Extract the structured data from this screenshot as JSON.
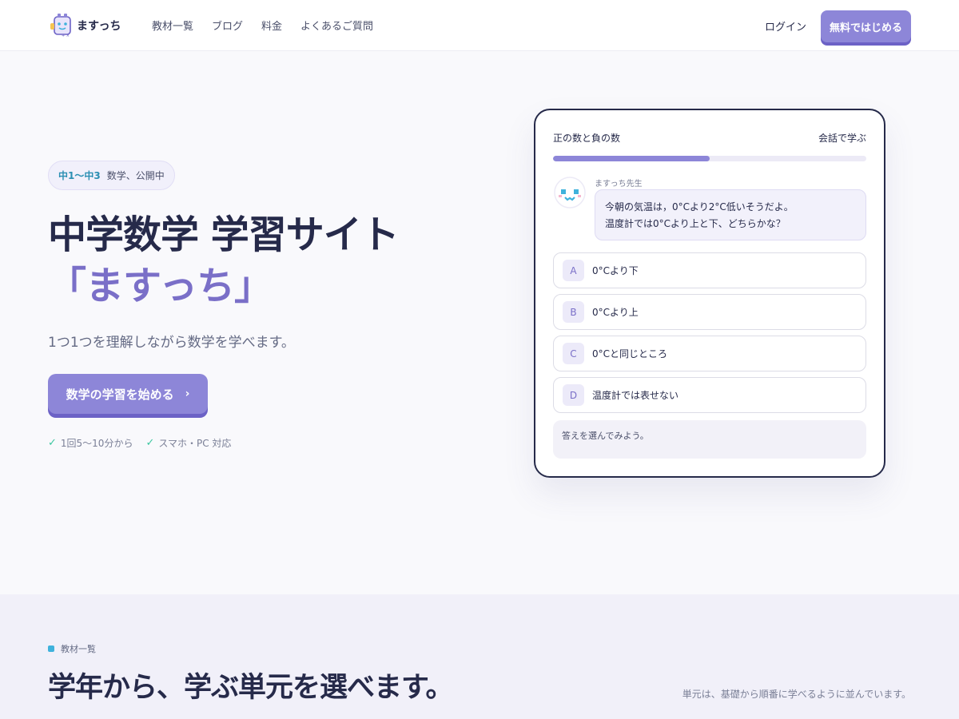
{
  "header": {
    "logo_text": "ますっち",
    "nav": [
      "教材一覧",
      "ブログ",
      "料金",
      "よくあるご質問"
    ],
    "login_label": "ログイン",
    "cta_label": "無料ではじめる"
  },
  "hero": {
    "badge_grade": "中1〜中3",
    "badge_text": "数学、公開中",
    "title_line1": "中学数学 学習サイト",
    "title_line2": "「ますっち」",
    "subtitle": "1つ1つを理解しながら数学を学べます。",
    "cta_label": "数学の学習を始める",
    "cta_arrow": "›",
    "features": [
      "1回5〜10分から",
      "スマホ・PC 対応"
    ],
    "check_icon": "✓"
  },
  "chat": {
    "topic": "正の数と負の数",
    "mode": "会話で学ぶ",
    "progress": 0.5,
    "teacher_name": "ますっち先生",
    "message_line1": "今朝の気温は，0°Cより2°C低いそうだよ。",
    "message_line2": "温度計では0°Cより上と下、どちらかな？",
    "options": [
      {
        "letter": "A",
        "text": "0°Cより下"
      },
      {
        "letter": "B",
        "text": "0°Cより上"
      },
      {
        "letter": "C",
        "text": "0°Cと同じところ"
      },
      {
        "letter": "D",
        "text": "温度計では表せない"
      }
    ],
    "hint": "答えを選んでみよう。"
  },
  "section2": {
    "label": "教材一覧",
    "title": "学年から、学ぶ単元を選べます。",
    "note": "単元は、基礎から順番に学べるように並んでいます。"
  },
  "colors": {
    "accent": "#8d86d8",
    "accent_dark": "#6c62c6",
    "title_purple": "#7a6fc8",
    "navy": "#262a4a",
    "check_green": "#3cc7a0",
    "label_blue": "#3fb2dc"
  }
}
